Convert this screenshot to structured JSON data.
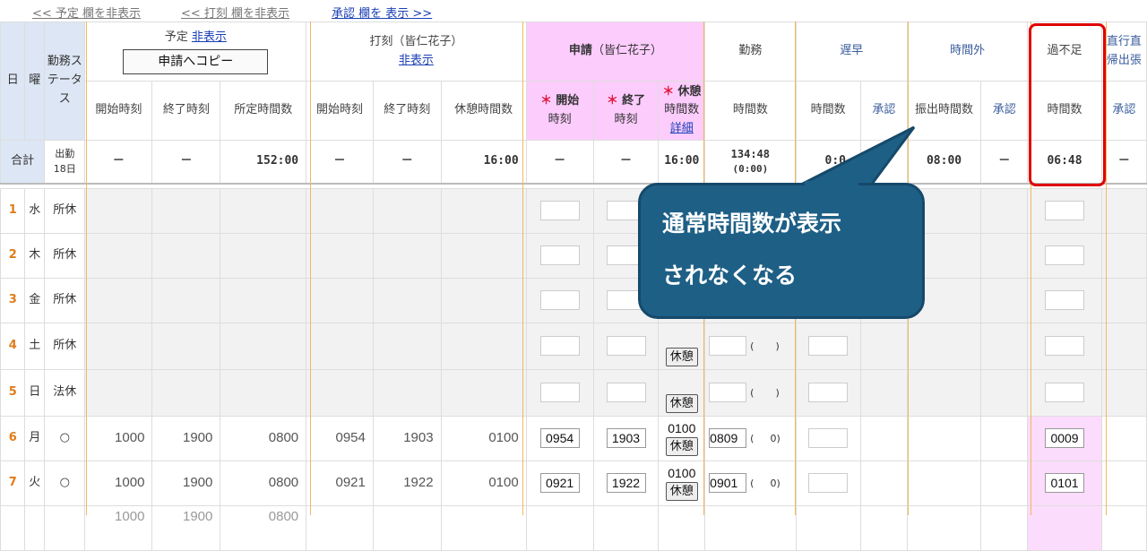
{
  "top_links": {
    "plan_hide": "<< 予定 欄を非表示",
    "punch_hide": "<< 打刻 欄を非表示",
    "approve_show": "承認 欄を 表示 >>"
  },
  "header": {
    "day": "日",
    "dow": "曜",
    "status": "勤務ステータス",
    "plan_group": "予定",
    "plan_hide": "非表示",
    "copy_button": "申請へコピー",
    "punch_group": "打刻（皆仁花子）",
    "punch_hide": "非表示",
    "apply_group": "申請",
    "apply_user": "（皆仁花子）",
    "work_group": "勤務",
    "late_group": "遅早",
    "overtime_group": "時間外",
    "shortage_group": "過不足",
    "direct_group": "直行直帰出張",
    "plan_start": "開始時刻",
    "plan_end": "終了時刻",
    "plan_hours": "所定時間数",
    "punch_start": "開始時刻",
    "punch_end": "終了時刻",
    "punch_break": "休憩時間数",
    "apply_start_mark": "＊",
    "apply_start": "開始",
    "apply_start_sub": "時刻",
    "apply_end_mark": "＊",
    "apply_end": "終了",
    "apply_end_sub": "時刻",
    "apply_break_mark": "＊",
    "apply_break": "休憩",
    "apply_break_sub": "時間数",
    "apply_break_detail": "詳細",
    "work_hours": "時間数",
    "late_hours": "時間数",
    "late_approve": "承認",
    "ot_hours": "振出時間数",
    "ot_approve": "承認",
    "shortage_hours": "時間数",
    "direct_approve": "承認"
  },
  "summary": {
    "label": "合計",
    "attend": "出勤",
    "attend_days": "18日",
    "plan_start": "－",
    "plan_end": "－",
    "plan_hours": "152:00",
    "punch_start": "－",
    "punch_end": "－",
    "punch_break": "16:00",
    "apply_start": "－",
    "apply_end": "－",
    "apply_break": "16:00",
    "work_hours": "134:48",
    "work_sub": "(0:00)",
    "late": "0:0",
    "ot": "08:00",
    "ot_approve": "－",
    "shortage": "06:48",
    "direct": "－"
  },
  "rows": [
    {
      "day": "1",
      "dow": "水",
      "status": "所休"
    },
    {
      "day": "2",
      "dow": "木",
      "status": "所休"
    },
    {
      "day": "3",
      "dow": "金",
      "status": "所休"
    },
    {
      "day": "4",
      "dow": "土",
      "status": "所休",
      "break_button": "休憩",
      "paren_open": "(",
      "paren_close": ")"
    },
    {
      "day": "5",
      "dow": "日",
      "status": "法休",
      "break_button": "休憩",
      "paren_open": "(",
      "paren_close": ")"
    },
    {
      "day": "6",
      "dow": "月",
      "status": "○",
      "plan_start": "1000",
      "plan_end": "1900",
      "plan_hours": "0800",
      "punch_start": "0954",
      "punch_end": "1903",
      "punch_break": "0100",
      "apply_start": "0954",
      "apply_end": "1903",
      "apply_break": "0100",
      "break_button": "休憩",
      "work": "0809",
      "paren_open": "(",
      "paren_zero": "0)",
      "shortage": "0009"
    },
    {
      "day": "7",
      "dow": "火",
      "status": "○",
      "plan_start": "1000",
      "plan_end": "1900",
      "plan_hours": "0800",
      "punch_start": "0921",
      "punch_end": "1922",
      "punch_break": "0100",
      "apply_start": "0921",
      "apply_end": "1922",
      "apply_break": "0100",
      "break_button": "休憩",
      "work": "0901",
      "paren_open": "(",
      "paren_zero": "0)",
      "shortage": "0101"
    }
  ],
  "partial_row": {
    "plan_start": "1000",
    "plan_end": "1900",
    "plan_hours": "0800"
  },
  "callout": {
    "line1": "通常時間数が表示",
    "line2": "されなくなる"
  },
  "colors": {
    "header_blue": "#dde6f4",
    "apply_pink": "#fcccfc",
    "callout_bg": "#1e5f86",
    "highlight_red": "#e00000",
    "day_orange": "#e07b1a"
  }
}
